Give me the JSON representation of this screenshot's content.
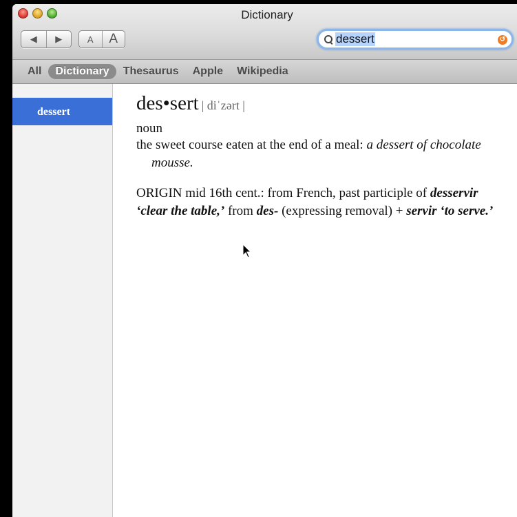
{
  "window": {
    "title": "Dictionary"
  },
  "toolbar": {
    "back_glyph": "◀",
    "forward_glyph": "▶",
    "font_smaller": "A",
    "font_larger": "A",
    "search_value": "dessert",
    "clear_glyph": "↺"
  },
  "sources": {
    "items": [
      {
        "label": "All"
      },
      {
        "label": "Dictionary"
      },
      {
        "label": "Thesaurus"
      },
      {
        "label": "Apple"
      },
      {
        "label": "Wikipedia"
      }
    ]
  },
  "sidebar": {
    "items": [
      {
        "label": "dessert"
      }
    ]
  },
  "entry": {
    "headword": "des•sert",
    "pronunciation": "| diˈzərt |",
    "part_of_speech": "noun",
    "definition": "the sweet course eaten at the end of a meal:",
    "example": "a dessert of chocolate mousse.",
    "origin": {
      "label": "ORIGIN",
      "text1": "mid 16th cent.: from French, past participle of",
      "term1": "desservir ‘clear the table,’",
      "text2": "from",
      "term2": "des-",
      "text3": "(expressing removal) +",
      "term3": "servir ‘to serve.’"
    }
  },
  "icons": [
    "close-icon",
    "minimize-icon",
    "zoom-icon",
    "search-icon",
    "clear-icon",
    "mouse-pointer-icon"
  ],
  "colors": {
    "selection": "#3a6fd8",
    "search_focus": "#8cb6ea",
    "clear_button": "#ee7c22"
  }
}
